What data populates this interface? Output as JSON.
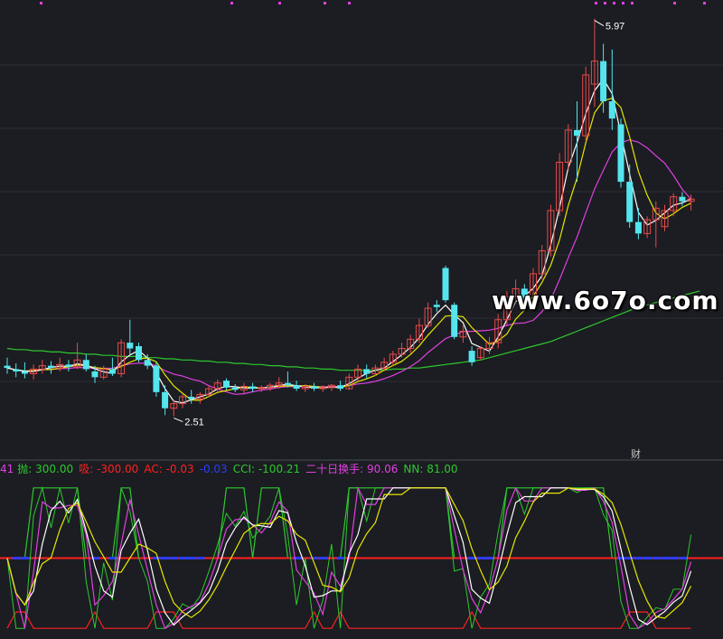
{
  "colors": {
    "background": "#1b1d22",
    "grid": "#2c2f36",
    "candle_up": "#e84a4a",
    "candle_down": "#54e5ef",
    "ma_fast": "#ffffff",
    "ma_mid": "#e6e600",
    "ma_slow": "#e040e0",
    "ma_long": "#2ec82e",
    "line_red": "#ff2020",
    "line_blue": "#2a3cff"
  },
  "price_panel": {
    "high_label": "5.97",
    "low_label": "2.51",
    "event_tag": "财"
  },
  "watermark": "www.6o7o.com",
  "indicator_header": {
    "first": "41",
    "pao_label": "抛: 300.00",
    "xi_label": "吸: -300.00",
    "ac_label": "AC: -0.03",
    "unnamed_label": "-0.03",
    "cci_label": "CCI: -100.21",
    "turnover_label": "二十日换手: 90.06",
    "nn_label": "NN: 81.00"
  },
  "chart_data": {
    "type": "line",
    "title": "",
    "price_marks": {
      "high": 5.97,
      "low": 2.51
    },
    "price_ylim": [
      2.2,
      6.1
    ],
    "candles": [
      {
        "o": 2.95,
        "h": 3.02,
        "l": 2.88,
        "c": 2.93
      },
      {
        "o": 2.92,
        "h": 2.97,
        "l": 2.85,
        "c": 2.9
      },
      {
        "o": 2.9,
        "h": 2.98,
        "l": 2.84,
        "c": 2.88
      },
      {
        "o": 2.88,
        "h": 2.96,
        "l": 2.83,
        "c": 2.92
      },
      {
        "o": 2.92,
        "h": 3.0,
        "l": 2.88,
        "c": 2.95
      },
      {
        "o": 2.95,
        "h": 2.99,
        "l": 2.88,
        "c": 2.93
      },
      {
        "o": 2.93,
        "h": 3.02,
        "l": 2.9,
        "c": 2.96
      },
      {
        "o": 2.96,
        "h": 3.0,
        "l": 2.9,
        "c": 2.94
      },
      {
        "o": 2.94,
        "h": 3.15,
        "l": 2.92,
        "c": 3.0
      },
      {
        "o": 3.0,
        "h": 3.05,
        "l": 2.9,
        "c": 2.92
      },
      {
        "o": 2.9,
        "h": 2.95,
        "l": 2.8,
        "c": 2.85
      },
      {
        "o": 2.85,
        "h": 2.95,
        "l": 2.83,
        "c": 2.92
      },
      {
        "o": 2.92,
        "h": 3.02,
        "l": 2.86,
        "c": 2.88
      },
      {
        "o": 2.88,
        "h": 3.18,
        "l": 2.85,
        "c": 3.15
      },
      {
        "o": 3.15,
        "h": 3.35,
        "l": 3.05,
        "c": 3.1
      },
      {
        "o": 3.12,
        "h": 3.15,
        "l": 2.98,
        "c": 3.0
      },
      {
        "o": 3.0,
        "h": 3.05,
        "l": 2.92,
        "c": 2.95
      },
      {
        "o": 2.95,
        "h": 2.98,
        "l": 2.68,
        "c": 2.72
      },
      {
        "o": 2.72,
        "h": 2.78,
        "l": 2.52,
        "c": 2.58
      },
      {
        "o": 2.58,
        "h": 2.65,
        "l": 2.51,
        "c": 2.62
      },
      {
        "o": 2.62,
        "h": 2.7,
        "l": 2.58,
        "c": 2.68
      },
      {
        "o": 2.68,
        "h": 2.74,
        "l": 2.62,
        "c": 2.66
      },
      {
        "o": 2.66,
        "h": 2.72,
        "l": 2.62,
        "c": 2.7
      },
      {
        "o": 2.7,
        "h": 2.78,
        "l": 2.68,
        "c": 2.75
      },
      {
        "o": 2.75,
        "h": 2.83,
        "l": 2.72,
        "c": 2.8
      },
      {
        "o": 2.82,
        "h": 2.84,
        "l": 2.74,
        "c": 2.76
      },
      {
        "o": 2.76,
        "h": 2.79,
        "l": 2.72,
        "c": 2.74
      },
      {
        "o": 2.74,
        "h": 2.8,
        "l": 2.7,
        "c": 2.77
      },
      {
        "o": 2.77,
        "h": 2.8,
        "l": 2.72,
        "c": 2.75
      },
      {
        "o": 2.75,
        "h": 2.78,
        "l": 2.72,
        "c": 2.76
      },
      {
        "o": 2.76,
        "h": 2.8,
        "l": 2.73,
        "c": 2.78
      },
      {
        "o": 2.78,
        "h": 2.85,
        "l": 2.75,
        "c": 2.8
      },
      {
        "o": 2.8,
        "h": 2.9,
        "l": 2.76,
        "c": 2.78
      },
      {
        "o": 2.78,
        "h": 2.82,
        "l": 2.73,
        "c": 2.75
      },
      {
        "o": 2.75,
        "h": 2.79,
        "l": 2.72,
        "c": 2.77
      },
      {
        "o": 2.77,
        "h": 2.8,
        "l": 2.73,
        "c": 2.75
      },
      {
        "o": 2.75,
        "h": 2.78,
        "l": 2.72,
        "c": 2.76
      },
      {
        "o": 2.76,
        "h": 2.79,
        "l": 2.73,
        "c": 2.78
      },
      {
        "o": 2.78,
        "h": 2.82,
        "l": 2.73,
        "c": 2.75
      },
      {
        "o": 2.75,
        "h": 2.88,
        "l": 2.74,
        "c": 2.85
      },
      {
        "o": 2.85,
        "h": 2.96,
        "l": 2.82,
        "c": 2.92
      },
      {
        "o": 2.92,
        "h": 2.96,
        "l": 2.84,
        "c": 2.88
      },
      {
        "o": 2.88,
        "h": 2.96,
        "l": 2.86,
        "c": 2.93
      },
      {
        "o": 2.93,
        "h": 3.02,
        "l": 2.9,
        "c": 2.98
      },
      {
        "o": 2.98,
        "h": 3.08,
        "l": 2.95,
        "c": 3.05
      },
      {
        "o": 3.05,
        "h": 3.15,
        "l": 3.02,
        "c": 3.1
      },
      {
        "o": 3.1,
        "h": 3.22,
        "l": 3.06,
        "c": 3.18
      },
      {
        "o": 3.18,
        "h": 3.36,
        "l": 3.15,
        "c": 3.3
      },
      {
        "o": 3.3,
        "h": 3.5,
        "l": 3.28,
        "c": 3.45
      },
      {
        "o": 3.48,
        "h": 3.52,
        "l": 3.42,
        "c": 3.46
      },
      {
        "o": 3.8,
        "h": 3.82,
        "l": 3.5,
        "c": 3.52
      },
      {
        "o": 3.48,
        "h": 3.5,
        "l": 3.18,
        "c": 3.2
      },
      {
        "o": 3.2,
        "h": 3.3,
        "l": 3.15,
        "c": 3.25
      },
      {
        "o": 3.08,
        "h": 3.12,
        "l": 2.95,
        "c": 2.98
      },
      {
        "o": 3.02,
        "h": 3.12,
        "l": 3.0,
        "c": 3.1
      },
      {
        "o": 3.1,
        "h": 3.2,
        "l": 3.05,
        "c": 3.15
      },
      {
        "o": 3.15,
        "h": 3.4,
        "l": 3.1,
        "c": 3.35
      },
      {
        "o": 3.35,
        "h": 3.6,
        "l": 3.3,
        "c": 3.55
      },
      {
        "o": 3.55,
        "h": 3.7,
        "l": 3.5,
        "c": 3.62
      },
      {
        "o": 3.62,
        "h": 3.66,
        "l": 3.48,
        "c": 3.5
      },
      {
        "o": 3.5,
        "h": 3.8,
        "l": 3.48,
        "c": 3.75
      },
      {
        "o": 3.75,
        "h": 4.0,
        "l": 3.7,
        "c": 3.95
      },
      {
        "o": 3.95,
        "h": 4.35,
        "l": 3.9,
        "c": 4.3
      },
      {
        "o": 4.3,
        "h": 4.8,
        "l": 4.25,
        "c": 4.72
      },
      {
        "o": 4.72,
        "h": 5.05,
        "l": 4.65,
        "c": 5.0
      },
      {
        "o": 5.0,
        "h": 5.25,
        "l": 4.55,
        "c": 4.95
      },
      {
        "o": 4.95,
        "h": 5.55,
        "l": 4.9,
        "c": 5.48
      },
      {
        "o": 5.4,
        "h": 5.97,
        "l": 5.2,
        "c": 5.6
      },
      {
        "o": 5.6,
        "h": 5.75,
        "l": 5.15,
        "c": 5.25
      },
      {
        "o": 5.25,
        "h": 5.7,
        "l": 5.0,
        "c": 5.1
      },
      {
        "o": 5.05,
        "h": 5.1,
        "l": 4.5,
        "c": 4.55
      },
      {
        "o": 4.55,
        "h": 4.7,
        "l": 4.15,
        "c": 4.2
      },
      {
        "o": 4.2,
        "h": 4.32,
        "l": 4.05,
        "c": 4.1
      },
      {
        "o": 4.1,
        "h": 4.25,
        "l": 4.06,
        "c": 4.22
      },
      {
        "o": 4.22,
        "h": 4.38,
        "l": 3.98,
        "c": 4.32
      },
      {
        "o": 4.16,
        "h": 4.35,
        "l": 4.12,
        "c": 4.3
      },
      {
        "o": 4.3,
        "h": 4.45,
        "l": 4.25,
        "c": 4.42
      },
      {
        "o": 4.42,
        "h": 4.46,
        "l": 4.34,
        "c": 4.38
      },
      {
        "o": 4.38,
        "h": 4.44,
        "l": 4.3,
        "c": 4.4
      }
    ],
    "ma_long_series": [
      3.1,
      3.09,
      3.09,
      3.08,
      3.08,
      3.07,
      3.07,
      3.06,
      3.06,
      3.05,
      3.05,
      3.04,
      3.04,
      3.03,
      3.03,
      3.03,
      3.02,
      3.02,
      3.01,
      3.01,
      3.0,
      3.0,
      2.99,
      2.99,
      2.98,
      2.98,
      2.97,
      2.97,
      2.96,
      2.96,
      2.95,
      2.95,
      2.94,
      2.94,
      2.93,
      2.93,
      2.92,
      2.92,
      2.91,
      2.91,
      2.91,
      2.91,
      2.91,
      2.91,
      2.92,
      2.92,
      2.93,
      2.93,
      2.94,
      2.95,
      2.96,
      2.97,
      2.98,
      2.99,
      3.0,
      3.02,
      3.04,
      3.06,
      3.08,
      3.1,
      3.12,
      3.14,
      3.16,
      3.19,
      3.22,
      3.25,
      3.28,
      3.31,
      3.34,
      3.37,
      3.4,
      3.43,
      3.46,
      3.48,
      3.5,
      3.52,
      3.54,
      3.56,
      3.58,
      3.6
    ],
    "indicator_ylim": [
      -330,
      330
    ],
    "indicator_flat_level": 0
  }
}
